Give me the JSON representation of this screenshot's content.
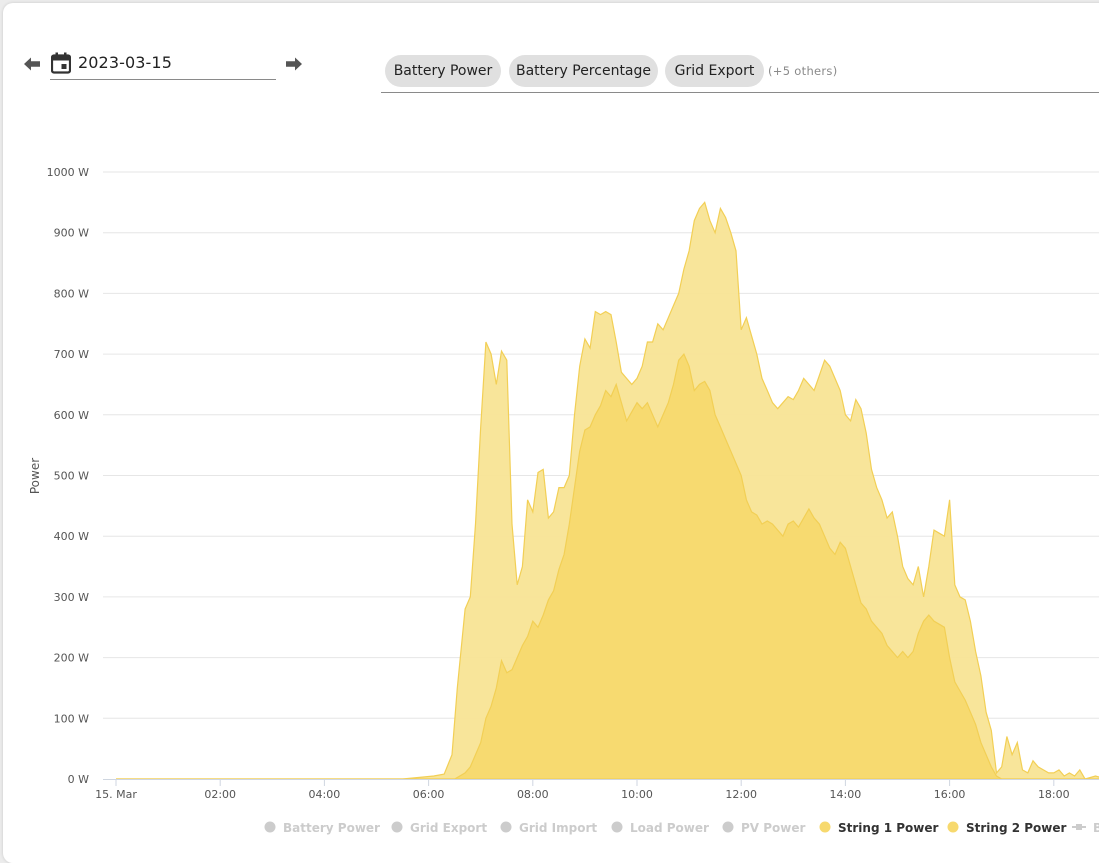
{
  "date_nav": {
    "date_value": "2023-03-15",
    "prev_icon": "arrow-left-icon",
    "next_icon": "arrow-right-icon",
    "calendar_icon": "calendar-icon"
  },
  "chips": {
    "items": [
      "Battery Power",
      "Battery Percentage",
      "Grid Export"
    ],
    "more_label": "(+5 others)"
  },
  "chart_data": {
    "type": "area",
    "ylabel": "Power",
    "ylim": [
      0,
      1000
    ],
    "y_ticks": [
      "0 W",
      "100 W",
      "200 W",
      "300 W",
      "400 W",
      "500 W",
      "600 W",
      "700 W",
      "800 W",
      "900 W",
      "1000 W"
    ],
    "x_ticks": [
      "15. Mar",
      "02:00",
      "04:00",
      "06:00",
      "08:00",
      "10:00",
      "12:00",
      "14:00",
      "16:00",
      "18:00"
    ],
    "grid": "horizontal",
    "legend_position": "bottom",
    "colors": {
      "fill": "#f7d96e",
      "fill_light": "#f8e495",
      "stroke": "#f2cf55",
      "hidden": "#cccccc"
    },
    "legend": [
      {
        "name": "Battery Power",
        "visible": false
      },
      {
        "name": "Grid Export",
        "visible": false
      },
      {
        "name": "Grid Import",
        "visible": false
      },
      {
        "name": "Load Power",
        "visible": false
      },
      {
        "name": "PV Power",
        "visible": false
      },
      {
        "name": "String 1 Power",
        "visible": true
      },
      {
        "name": "String 2 Power",
        "visible": true
      },
      {
        "name": "B",
        "visible": false
      }
    ],
    "x_unit": "hours",
    "series": [
      {
        "name": "String 1 Power",
        "values": [
          [
            0,
            0
          ],
          [
            5.5,
            0
          ],
          [
            6.1,
            5
          ],
          [
            6.3,
            8
          ],
          [
            6.45,
            40
          ],
          [
            6.55,
            150
          ],
          [
            6.7,
            280
          ],
          [
            6.8,
            300
          ],
          [
            6.9,
            420
          ],
          [
            7.0,
            580
          ],
          [
            7.1,
            720
          ],
          [
            7.2,
            700
          ],
          [
            7.3,
            650
          ],
          [
            7.4,
            705
          ],
          [
            7.5,
            690
          ],
          [
            7.6,
            420
          ],
          [
            7.7,
            320
          ],
          [
            7.8,
            350
          ],
          [
            7.9,
            460
          ],
          [
            8.0,
            440
          ],
          [
            8.1,
            505
          ],
          [
            8.2,
            510
          ],
          [
            8.3,
            430
          ],
          [
            8.4,
            440
          ],
          [
            8.5,
            480
          ],
          [
            8.6,
            480
          ],
          [
            8.7,
            500
          ],
          [
            8.8,
            600
          ],
          [
            8.9,
            680
          ],
          [
            9.0,
            725
          ],
          [
            9.1,
            710
          ],
          [
            9.2,
            770
          ],
          [
            9.3,
            765
          ],
          [
            9.4,
            770
          ],
          [
            9.5,
            765
          ],
          [
            9.6,
            720
          ],
          [
            9.7,
            670
          ],
          [
            9.8,
            660
          ],
          [
            9.9,
            650
          ],
          [
            10.0,
            660
          ],
          [
            10.1,
            680
          ],
          [
            10.2,
            720
          ],
          [
            10.3,
            720
          ],
          [
            10.4,
            750
          ],
          [
            10.5,
            740
          ],
          [
            10.6,
            760
          ],
          [
            10.7,
            780
          ],
          [
            10.8,
            800
          ],
          [
            10.9,
            840
          ],
          [
            11.0,
            870
          ],
          [
            11.1,
            920
          ],
          [
            11.2,
            940
          ],
          [
            11.3,
            950
          ],
          [
            11.4,
            920
          ],
          [
            11.5,
            900
          ],
          [
            11.6,
            940
          ],
          [
            11.7,
            925
          ],
          [
            11.8,
            900
          ],
          [
            11.9,
            870
          ],
          [
            12.0,
            740
          ],
          [
            12.1,
            760
          ],
          [
            12.2,
            730
          ],
          [
            12.3,
            700
          ],
          [
            12.4,
            660
          ],
          [
            12.5,
            640
          ],
          [
            12.6,
            620
          ],
          [
            12.7,
            610
          ],
          [
            12.8,
            620
          ],
          [
            12.9,
            630
          ],
          [
            13.0,
            625
          ],
          [
            13.1,
            640
          ],
          [
            13.2,
            660
          ],
          [
            13.3,
            650
          ],
          [
            13.4,
            640
          ],
          [
            13.5,
            665
          ],
          [
            13.6,
            690
          ],
          [
            13.7,
            680
          ],
          [
            13.8,
            660
          ],
          [
            13.9,
            640
          ],
          [
            14.0,
            600
          ],
          [
            14.1,
            590
          ],
          [
            14.2,
            625
          ],
          [
            14.3,
            610
          ],
          [
            14.4,
            570
          ],
          [
            14.5,
            510
          ],
          [
            14.6,
            480
          ],
          [
            14.7,
            460
          ],
          [
            14.8,
            430
          ],
          [
            14.9,
            440
          ],
          [
            15.0,
            400
          ],
          [
            15.1,
            350
          ],
          [
            15.2,
            330
          ],
          [
            15.3,
            320
          ],
          [
            15.4,
            350
          ],
          [
            15.5,
            300
          ],
          [
            15.6,
            350
          ],
          [
            15.7,
            410
          ],
          [
            15.8,
            405
          ],
          [
            15.9,
            400
          ],
          [
            16.0,
            460
          ],
          [
            16.1,
            320
          ],
          [
            16.2,
            300
          ],
          [
            16.3,
            295
          ],
          [
            16.4,
            260
          ],
          [
            16.5,
            210
          ],
          [
            16.6,
            170
          ],
          [
            16.7,
            110
          ],
          [
            16.8,
            80
          ],
          [
            16.9,
            10
          ],
          [
            17.0,
            20
          ],
          [
            17.1,
            70
          ],
          [
            17.2,
            40
          ],
          [
            17.3,
            60
          ],
          [
            17.4,
            15
          ],
          [
            17.5,
            10
          ],
          [
            17.6,
            30
          ],
          [
            17.7,
            20
          ],
          [
            17.8,
            15
          ],
          [
            17.9,
            10
          ],
          [
            18.0,
            10
          ],
          [
            18.1,
            15
          ],
          [
            18.2,
            5
          ],
          [
            18.3,
            10
          ],
          [
            18.4,
            5
          ],
          [
            18.5,
            15
          ],
          [
            18.6,
            0
          ],
          [
            18.8,
            5
          ],
          [
            19.0,
            0
          ]
        ]
      },
      {
        "name": "String 2 Power",
        "values": [
          [
            0,
            0
          ],
          [
            6.5,
            0
          ],
          [
            6.7,
            10
          ],
          [
            6.8,
            20
          ],
          [
            6.9,
            40
          ],
          [
            7.0,
            60
          ],
          [
            7.1,
            100
          ],
          [
            7.2,
            120
          ],
          [
            7.3,
            150
          ],
          [
            7.4,
            195
          ],
          [
            7.5,
            175
          ],
          [
            7.6,
            180
          ],
          [
            7.7,
            200
          ],
          [
            7.8,
            220
          ],
          [
            7.9,
            235
          ],
          [
            8.0,
            260
          ],
          [
            8.1,
            250
          ],
          [
            8.2,
            270
          ],
          [
            8.3,
            295
          ],
          [
            8.4,
            310
          ],
          [
            8.5,
            345
          ],
          [
            8.6,
            370
          ],
          [
            8.7,
            420
          ],
          [
            8.8,
            480
          ],
          [
            8.9,
            540
          ],
          [
            9.0,
            575
          ],
          [
            9.1,
            580
          ],
          [
            9.2,
            600
          ],
          [
            9.3,
            615
          ],
          [
            9.4,
            640
          ],
          [
            9.5,
            630
          ],
          [
            9.6,
            650
          ],
          [
            9.7,
            620
          ],
          [
            9.8,
            590
          ],
          [
            9.9,
            605
          ],
          [
            10.0,
            620
          ],
          [
            10.1,
            610
          ],
          [
            10.2,
            620
          ],
          [
            10.3,
            600
          ],
          [
            10.4,
            580
          ],
          [
            10.5,
            600
          ],
          [
            10.6,
            620
          ],
          [
            10.7,
            650
          ],
          [
            10.8,
            690
          ],
          [
            10.9,
            700
          ],
          [
            11.0,
            680
          ],
          [
            11.1,
            640
          ],
          [
            11.2,
            650
          ],
          [
            11.3,
            655
          ],
          [
            11.4,
            640
          ],
          [
            11.5,
            600
          ],
          [
            11.6,
            580
          ],
          [
            11.7,
            560
          ],
          [
            11.8,
            540
          ],
          [
            11.9,
            520
          ],
          [
            12.0,
            500
          ],
          [
            12.1,
            460
          ],
          [
            12.2,
            440
          ],
          [
            12.3,
            435
          ],
          [
            12.4,
            420
          ],
          [
            12.5,
            425
          ],
          [
            12.6,
            420
          ],
          [
            12.7,
            410
          ],
          [
            12.8,
            400
          ],
          [
            12.9,
            420
          ],
          [
            13.0,
            425
          ],
          [
            13.1,
            415
          ],
          [
            13.2,
            430
          ],
          [
            13.3,
            445
          ],
          [
            13.4,
            430
          ],
          [
            13.5,
            420
          ],
          [
            13.6,
            400
          ],
          [
            13.7,
            380
          ],
          [
            13.8,
            370
          ],
          [
            13.9,
            390
          ],
          [
            14.0,
            380
          ],
          [
            14.1,
            350
          ],
          [
            14.2,
            320
          ],
          [
            14.3,
            290
          ],
          [
            14.4,
            280
          ],
          [
            14.5,
            260
          ],
          [
            14.6,
            250
          ],
          [
            14.7,
            240
          ],
          [
            14.8,
            220
          ],
          [
            14.9,
            210
          ],
          [
            15.0,
            200
          ],
          [
            15.1,
            210
          ],
          [
            15.2,
            200
          ],
          [
            15.3,
            210
          ],
          [
            15.4,
            240
          ],
          [
            15.5,
            260
          ],
          [
            15.6,
            270
          ],
          [
            15.7,
            260
          ],
          [
            15.8,
            255
          ],
          [
            15.9,
            250
          ],
          [
            16.0,
            200
          ],
          [
            16.1,
            160
          ],
          [
            16.2,
            145
          ],
          [
            16.3,
            130
          ],
          [
            16.4,
            110
          ],
          [
            16.5,
            90
          ],
          [
            16.6,
            60
          ],
          [
            16.7,
            40
          ],
          [
            16.8,
            20
          ],
          [
            16.9,
            5
          ],
          [
            17.0,
            0
          ],
          [
            19.0,
            0
          ]
        ]
      }
    ]
  }
}
